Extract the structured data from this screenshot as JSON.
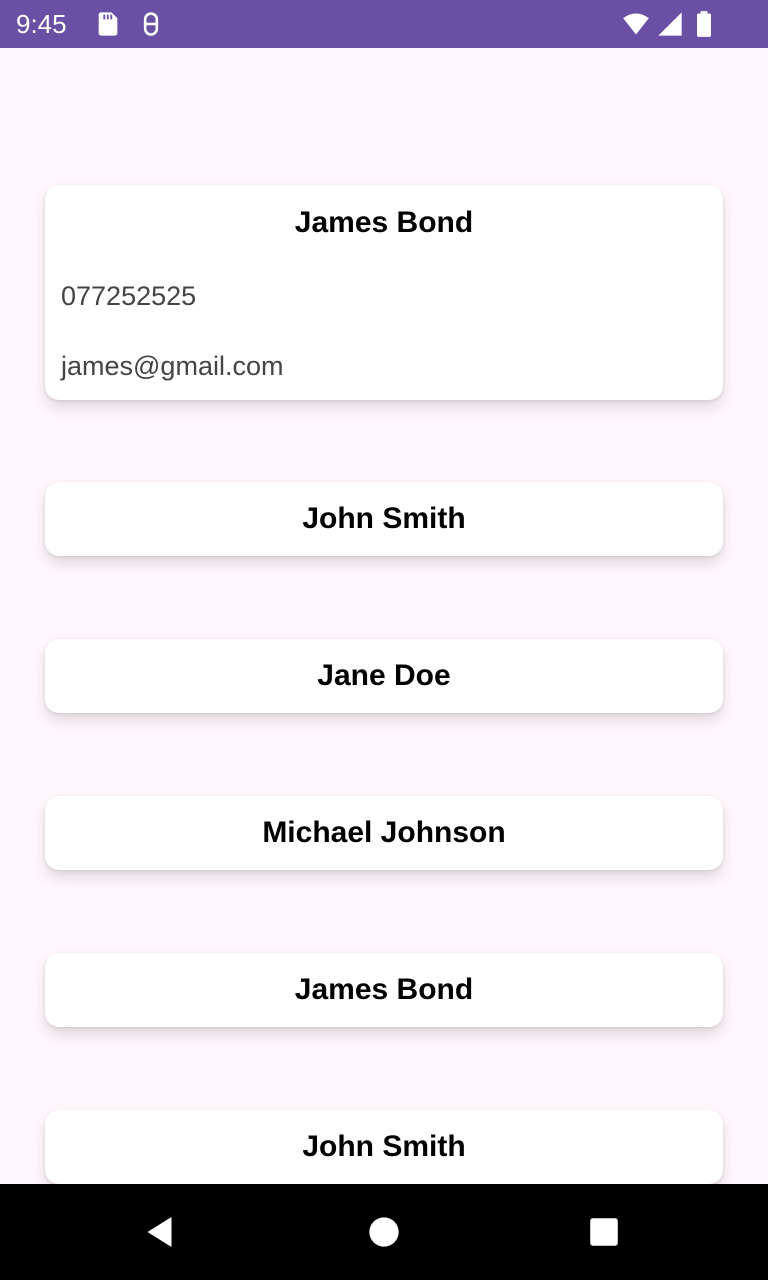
{
  "status_bar": {
    "time": "9:45",
    "background": "#6A50A4",
    "icons": [
      "sd-card-icon",
      "debug-icon",
      "wifi-icon",
      "signal-icon",
      "battery-icon"
    ]
  },
  "contacts": [
    {
      "name": "James Bond",
      "expanded": true,
      "phone": "077252525",
      "email": "james@gmail.com"
    },
    {
      "name": "John Smith",
      "expanded": false
    },
    {
      "name": "Jane Doe",
      "expanded": false
    },
    {
      "name": "Michael Johnson",
      "expanded": false
    },
    {
      "name": "James Bond",
      "expanded": false
    },
    {
      "name": "John Smith",
      "expanded": false
    }
  ],
  "nav_bar": {
    "buttons": [
      "back-icon",
      "home-icon",
      "recents-icon"
    ]
  }
}
